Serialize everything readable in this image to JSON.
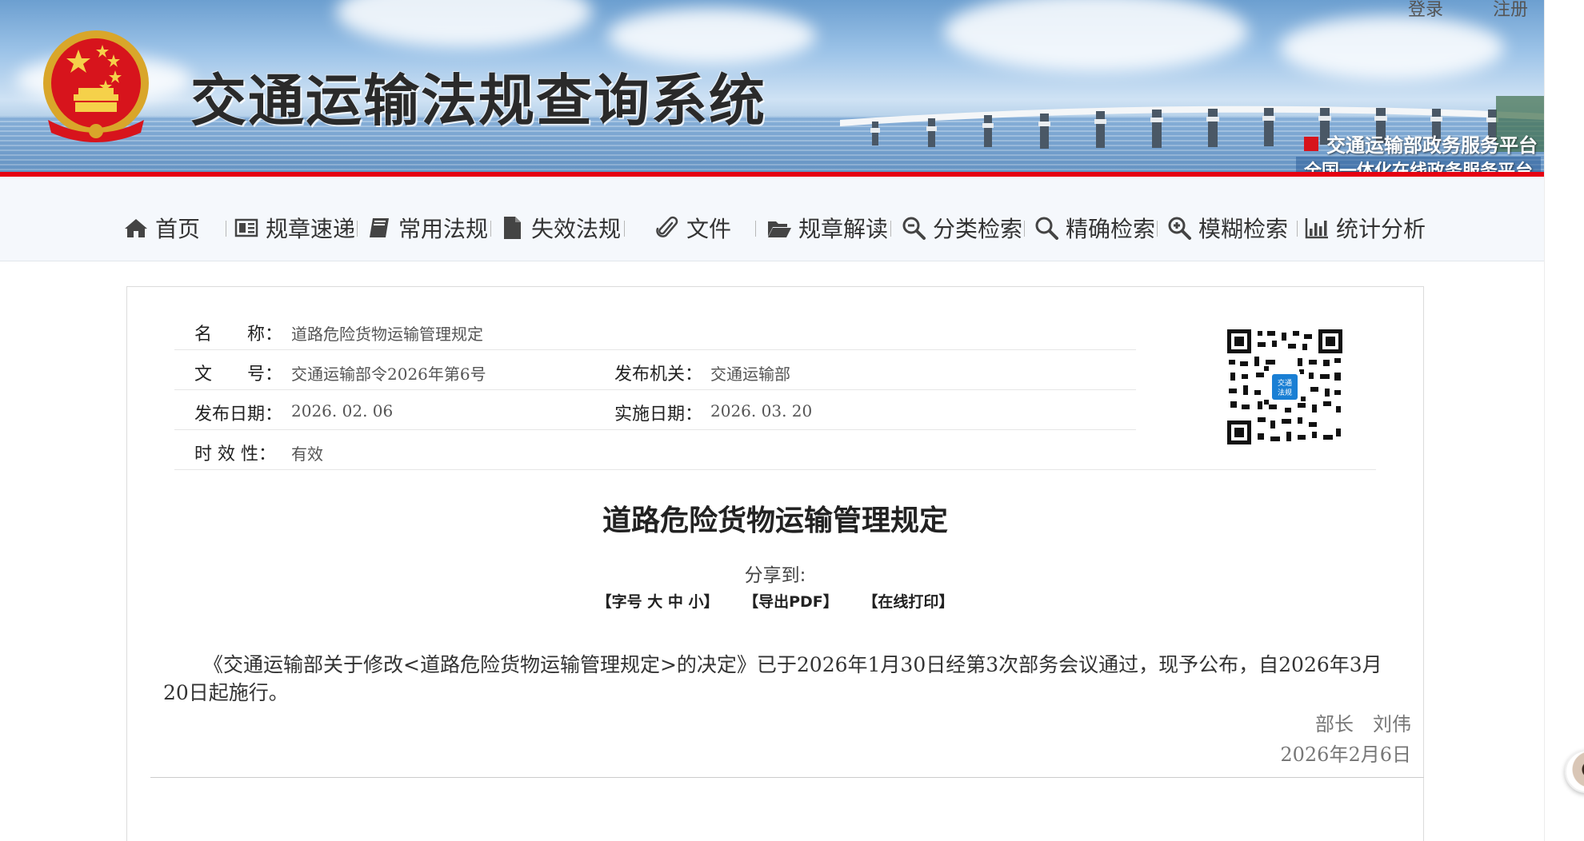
{
  "header": {
    "site_title": "交通运输法规查询系统",
    "top_links": {
      "login": "登录",
      "register": "注册"
    },
    "platform_line1": "交通运输部政务服务平台",
    "platform_line2": "全国一体化在线政务服务平台",
    "accent_red": "#e60012"
  },
  "nav": {
    "items": [
      {
        "label": "首页",
        "icon": "home-icon"
      },
      {
        "label": "规章速递",
        "icon": "newspaper-icon"
      },
      {
        "label": "常用法规",
        "icon": "book-icon"
      },
      {
        "label": "失效法规",
        "icon": "file-icon"
      },
      {
        "label": "文件",
        "icon": "paperclip-icon"
      },
      {
        "label": "规章解读",
        "icon": "folder-open-icon"
      },
      {
        "label": "分类检索",
        "icon": "search-minus-icon"
      },
      {
        "label": "精确检索",
        "icon": "search-icon"
      },
      {
        "label": "模糊检索",
        "icon": "search-plus-icon"
      },
      {
        "label": "统计分析",
        "icon": "bar-chart-icon"
      }
    ]
  },
  "meta": {
    "name_label": "名　　称：",
    "name_value": "道路危险货物运输管理规定",
    "docno_label": "文　　号：",
    "docno_value": "交通运输部令2026年第6号",
    "issuer_label": "发布机关：",
    "issuer_value": "交通运输部",
    "pubdate_label": "发布日期：",
    "pubdate_value": "2026. 02. 06",
    "effdate_label": "实施日期：",
    "effdate_value": "2026. 03. 20",
    "validity_label": "时 效 性：",
    "validity_value": "有效",
    "qr_badge_line1": "交通",
    "qr_badge_line2": "法规"
  },
  "document": {
    "title": "道路危险货物运输管理规定",
    "share_label": "分享到:",
    "tools": {
      "font_size": "【字号 大 中 小】",
      "export_pdf": "【导出PDF】",
      "print": "【在线打印】"
    },
    "body": "《交通运输部关于修改<道路危险货物运输管理规定>的决定》已于2026年1月30日经第3次部务会议通过，现予公布，自2026年3月20日起施行。",
    "signer": "部长　刘伟",
    "sign_date": "2026年2月6日"
  }
}
